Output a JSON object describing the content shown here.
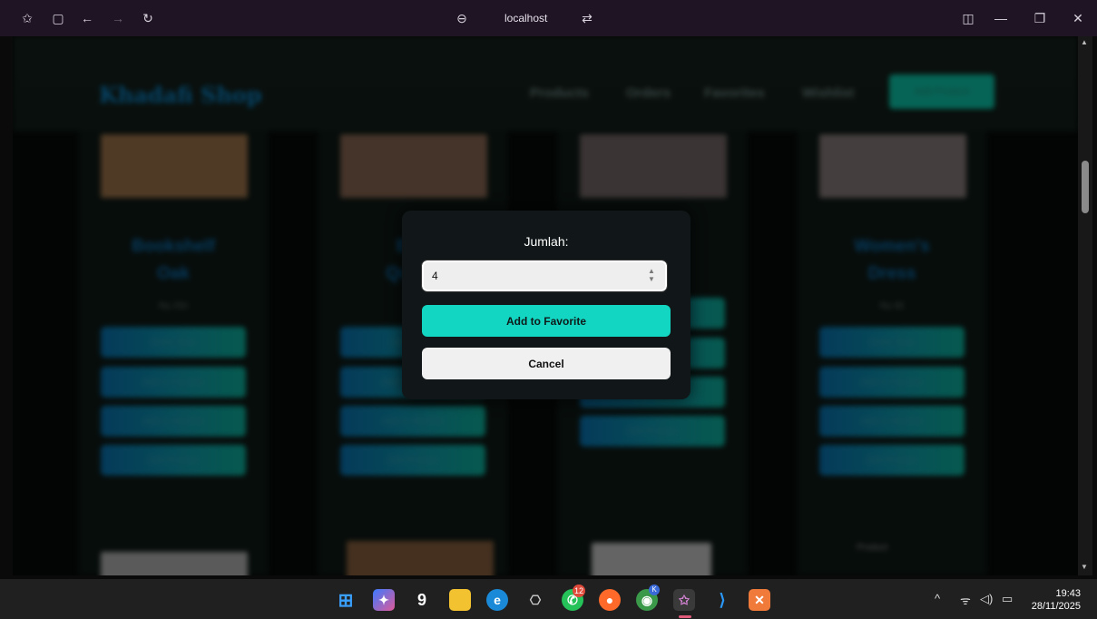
{
  "browser": {
    "url": "localhost",
    "icons": [
      "favorites-icon",
      "sidebar-icon",
      "back-icon",
      "forward-icon",
      "refresh-icon",
      "site-info-icon",
      "reader-icon",
      "split-view-icon",
      "minimize-icon",
      "restore-icon",
      "close-icon"
    ]
  },
  "page": {
    "brand": "Khadafi Shop",
    "nav": [
      "Products",
      "Orders",
      "Favorites",
      "Wishlist"
    ],
    "add_product": "Add Product",
    "products": [
      {
        "title_line1": "Bookshelf",
        "title_line2": "Oak",
        "price": "Rp 250",
        "image_color": "#7a5a3a"
      },
      {
        "title_line1": "Bed",
        "title_line2": "Queen",
        "price": "Rp",
        "image_color": "#6a5040"
      },
      {
        "title_line1": "",
        "title_line2": "",
        "price": "",
        "image_color": "#5a5050"
      },
      {
        "title_line1": "Women's",
        "title_line2": "Dress",
        "price": "Rp 85",
        "image_color": "#6a6060"
      }
    ],
    "buttons": [
      "Order Now",
      "Add to Favorite",
      "Add to Wishlist",
      "Edit Product"
    ],
    "lower_image_alt": "Product"
  },
  "modal": {
    "label": "Jumlah:",
    "quantity_value": "4",
    "add_button": "Add to Favorite",
    "cancel_button": "Cancel"
  },
  "taskbar": {
    "apps": [
      "windows-start",
      "copilot",
      "search-9",
      "file-explorer",
      "edge",
      "chatgpt",
      "whatsapp",
      "firefox",
      "chrome",
      "browser-active",
      "vscode",
      "xampp"
    ],
    "whatsapp_badge": "12",
    "chrome_badge": "K",
    "time": "19:43",
    "date": "28/11/2025"
  },
  "colors": {
    "accent": "#12d6c1",
    "titlebar": "#1f1424",
    "taskbar": "#202020"
  }
}
